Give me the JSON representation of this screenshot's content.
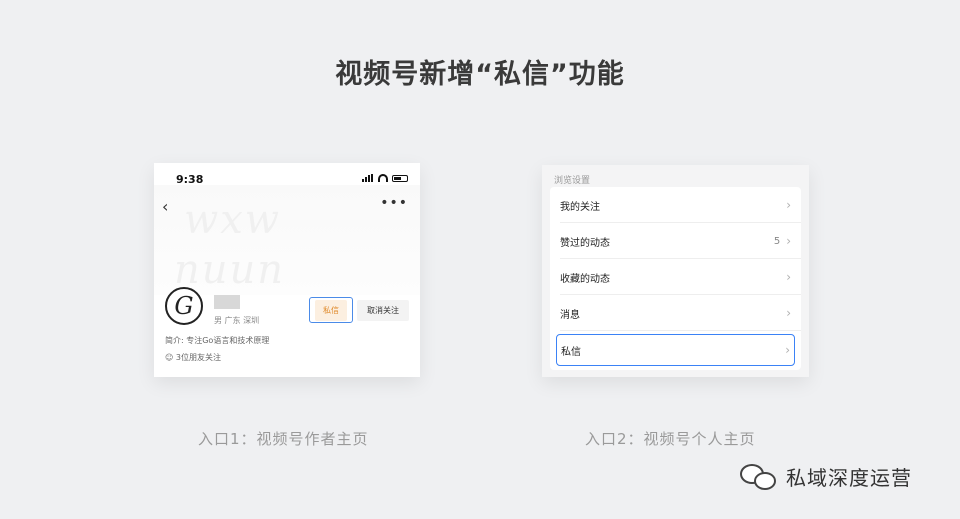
{
  "title": "视频号新增“私信”功能",
  "left_screen": {
    "time": "9:38",
    "gender_location": "男  广东 深圳",
    "dm_button": "私信",
    "unfollow_button": "取消关注",
    "bio": "简介: 专注Go语言和技术原理",
    "friends": "3位朋友关注",
    "caption": "入口1：视频号作者主页"
  },
  "right_screen": {
    "section_header": "浏览设置",
    "items": [
      {
        "label": "我的关注",
        "count": ""
      },
      {
        "label": "赞过的动态",
        "count": "5"
      },
      {
        "label": "收藏的动态",
        "count": ""
      },
      {
        "label": "消息",
        "count": ""
      },
      {
        "label": "私信",
        "count": ""
      }
    ],
    "caption": "入口2：视频号个人主页"
  },
  "brand": {
    "name": "私域深度运营",
    "icon": "wechat-icon"
  }
}
